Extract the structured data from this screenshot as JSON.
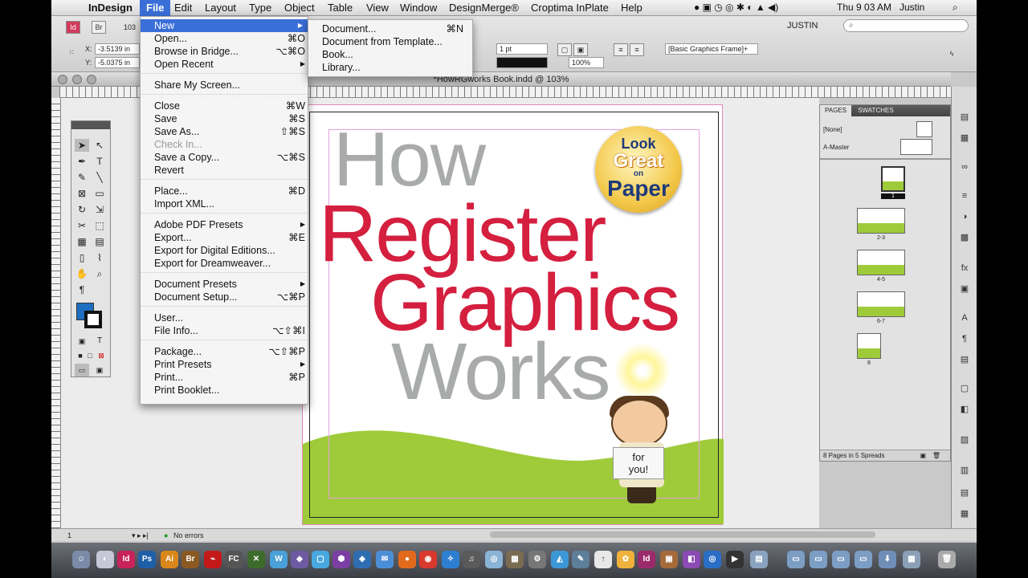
{
  "menubar": {
    "app_name": "InDesign",
    "items": [
      "File",
      "Edit",
      "Layout",
      "Type",
      "Object",
      "Table",
      "View",
      "Window",
      "DesignMerge®",
      "Croptima InPlate",
      "Help"
    ],
    "clock": "Thu 9 03 AM",
    "user": "Justin"
  },
  "control": {
    "x_label": "X:",
    "y_label": "Y:",
    "x_value": "-3.5139 in",
    "y_value": "-5.0375 in",
    "zoom_value": "103",
    "stroke_weight": "1 pt",
    "scale_value": "100%",
    "frame_style": "[Basic Graphics Frame]+",
    "workspace": "JUSTIN",
    "search_icon": "search-icon"
  },
  "document": {
    "title": "*HowRGworks Book.indd @ 103%",
    "status": "No errors",
    "page_num": "1"
  },
  "artwork": {
    "how": "How",
    "register": "Register",
    "graphics": "Graphics",
    "works": "Works",
    "logo_look": "Look",
    "logo_great": "Great",
    "logo_on": "on",
    "logo_paper": "Paper",
    "sign_line1": "for",
    "sign_line2": "you!"
  },
  "colors": {
    "gray_text": "#a9abab",
    "red_text": "#d41f3f",
    "green_hill": "#9fcb3a",
    "menu_highlight": "#3a6fd8"
  },
  "file_menu": {
    "items": [
      {
        "label": "New",
        "shortcut": "",
        "submenu": true,
        "highlight": true
      },
      {
        "label": "Open...",
        "shortcut": "⌘O"
      },
      {
        "label": "Browse in Bridge...",
        "shortcut": "⌥⌘O"
      },
      {
        "label": "Open Recent",
        "shortcut": "",
        "submenu": true
      },
      {
        "label": "Share My Screen...",
        "shortcut": ""
      },
      {
        "label": "Close",
        "shortcut": "⌘W"
      },
      {
        "label": "Save",
        "shortcut": "⌘S"
      },
      {
        "label": "Save As...",
        "shortcut": "⇧⌘S"
      },
      {
        "label": "Check In...",
        "shortcut": "",
        "disabled": true
      },
      {
        "label": "Save a Copy...",
        "shortcut": "⌥⌘S"
      },
      {
        "label": "Revert",
        "shortcut": ""
      },
      {
        "label": "Place...",
        "shortcut": "⌘D"
      },
      {
        "label": "Import XML...",
        "shortcut": ""
      },
      {
        "label": "Adobe PDF Presets",
        "shortcut": "",
        "submenu": true
      },
      {
        "label": "Export...",
        "shortcut": "⌘E"
      },
      {
        "label": "Export for Digital Editions...",
        "shortcut": ""
      },
      {
        "label": "Export for Dreamweaver...",
        "shortcut": ""
      },
      {
        "label": "Document Presets",
        "shortcut": "",
        "submenu": true
      },
      {
        "label": "Document Setup...",
        "shortcut": "⌥⌘P"
      },
      {
        "label": "User...",
        "shortcut": ""
      },
      {
        "label": "File Info...",
        "shortcut": "⌥⇧⌘I"
      },
      {
        "label": "Package...",
        "shortcut": "⌥⇧⌘P"
      },
      {
        "label": "Print Presets",
        "shortcut": "",
        "submenu": true
      },
      {
        "label": "Print...",
        "shortcut": "⌘P"
      },
      {
        "label": "Print Booklet...",
        "shortcut": ""
      }
    ]
  },
  "new_submenu": {
    "items": [
      {
        "label": "Document...",
        "shortcut": "⌘N"
      },
      {
        "label": "Document from Template...",
        "shortcut": ""
      },
      {
        "label": "Book...",
        "shortcut": ""
      },
      {
        "label": "Library...",
        "shortcut": ""
      }
    ]
  },
  "pages_panel": {
    "tab_pages": "PAGES",
    "tab_swatches": "SWATCHES",
    "none_label": "[None]",
    "master_label": "A-Master",
    "page_labels": [
      "1",
      "2-3",
      "4-5",
      "6-7",
      "8"
    ],
    "footer": "8 Pages in 5 Spreads"
  },
  "dock": {
    "apps": [
      "Id",
      "Ps",
      "Ai",
      "Br",
      "FC",
      "Id"
    ]
  }
}
